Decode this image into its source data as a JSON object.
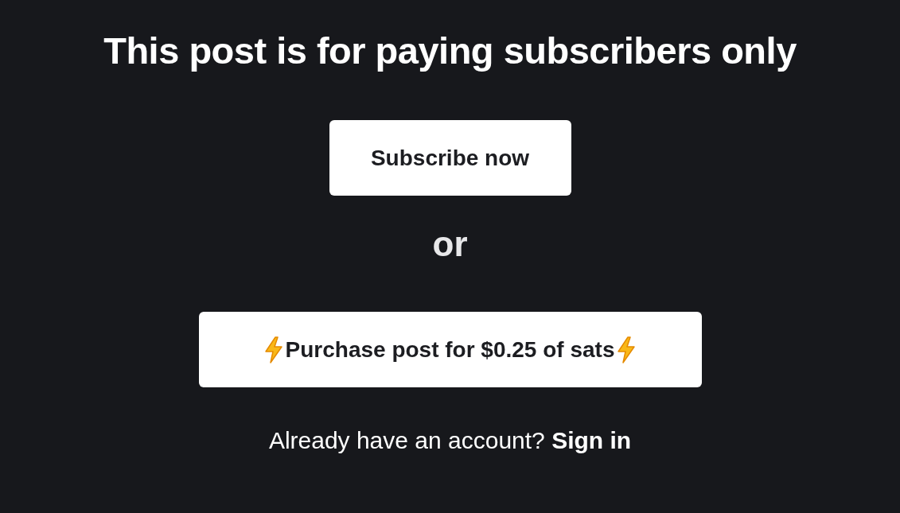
{
  "title": "This post is for paying subscribers only",
  "subscribe_button": "Subscribe now",
  "separator": "or",
  "purchase_button": {
    "label": "Purchase post for $0.25 of sats"
  },
  "sign_in": {
    "prompt": "Already have an account?",
    "link": "Sign in"
  }
}
